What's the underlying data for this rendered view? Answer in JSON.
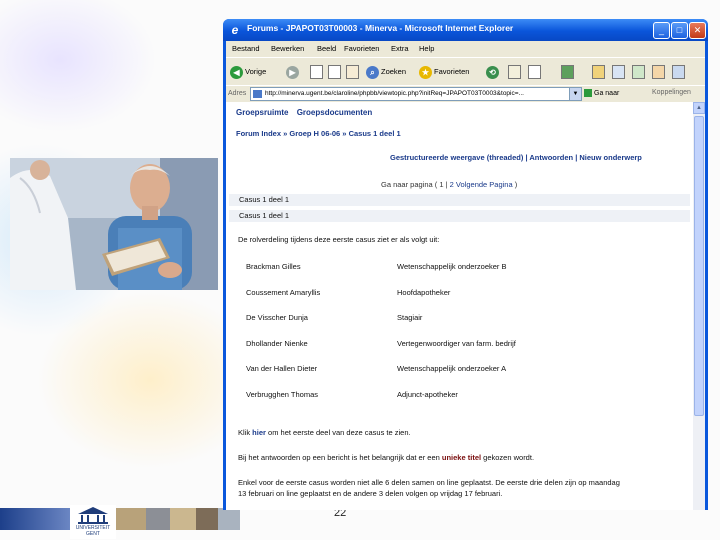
{
  "window": {
    "title": "Forums - JPAPOT03T00003 - Minerva - Microsoft Internet Explorer",
    "buttons": {
      "minimize": "_",
      "maximize": "□",
      "close": "✕"
    }
  },
  "menu": [
    "Bestand",
    "Bewerken",
    "Beeld",
    "Favorieten",
    "Extra",
    "Help"
  ],
  "toolbar": {
    "back": "Vorige",
    "search": "Zoeken",
    "favorites": "Favorieten"
  },
  "address": {
    "label": "Adres",
    "url": "http://minerva.ugent.be/claroline/phpbb/viewtopic.php?initReq=JPAPOT03T0003&topic=...",
    "go": "Ga naar",
    "links": "Koppelingen"
  },
  "forum": {
    "top_links": [
      "Groepsruimte",
      "Groepsdocumenten"
    ],
    "breadcrumb": [
      "Forum Index",
      "Groep H 06-06",
      "Casus 1 deel 1"
    ],
    "breadcrumb_sep": " » ",
    "view_links": "Gestructureerde weergave (threaded) | Antwoorden | Nieuw onderwerp",
    "pagination": {
      "prefix": "Ga naar pagina ( 1 |",
      "next": "2 Volgende Pagina",
      "suffix": ")"
    },
    "thread_title": "Casus 1 deel 1",
    "post_title": "Casus 1 deel 1",
    "intro": "De rolverdeling tijdens deze eerste casus ziet er als volgt uit:",
    "roles": [
      {
        "name": "Brackman Gilles",
        "role": "Wetenschappelijk onderzoeker B"
      },
      {
        "name": "Coussement Amaryllis",
        "role": "Hoofdapotheker"
      },
      {
        "name": "De Visscher Dunja",
        "role": "Stagiair"
      },
      {
        "name": "Dhollander Nienke",
        "role": "Vertegenwoordiger van farm. bedrijf"
      },
      {
        "name": "Van der Hallen Dieter",
        "role": "Wetenschappelijk onderzoeker A"
      },
      {
        "name": "Verbrugghen Thomas",
        "role": "Adjunct-apotheker"
      }
    ],
    "click_prefix": "Klik ",
    "click_link": "hier",
    "click_suffix": " om het eerste deel van deze casus te zien.",
    "note_prefix": "Bij het antwoorden op een bericht is het belangrijk dat er een ",
    "note_bold": "unieke titel",
    "note_suffix": " gekozen wordt.",
    "info_line1": "Enkel voor de eerste casus worden niet alle 6 delen samen on line geplaatst. De eerste drie delen zijn op maandag",
    "info_line2": "13 februari on line geplaatst en de andere 3 delen volgen op vrijdag 17 februari."
  },
  "slide": {
    "number": "22",
    "logo_text": "UNIVERSITEIT GENT"
  },
  "colors": {
    "ie_title": "#0a55da",
    "link": "#1a3a8a"
  }
}
